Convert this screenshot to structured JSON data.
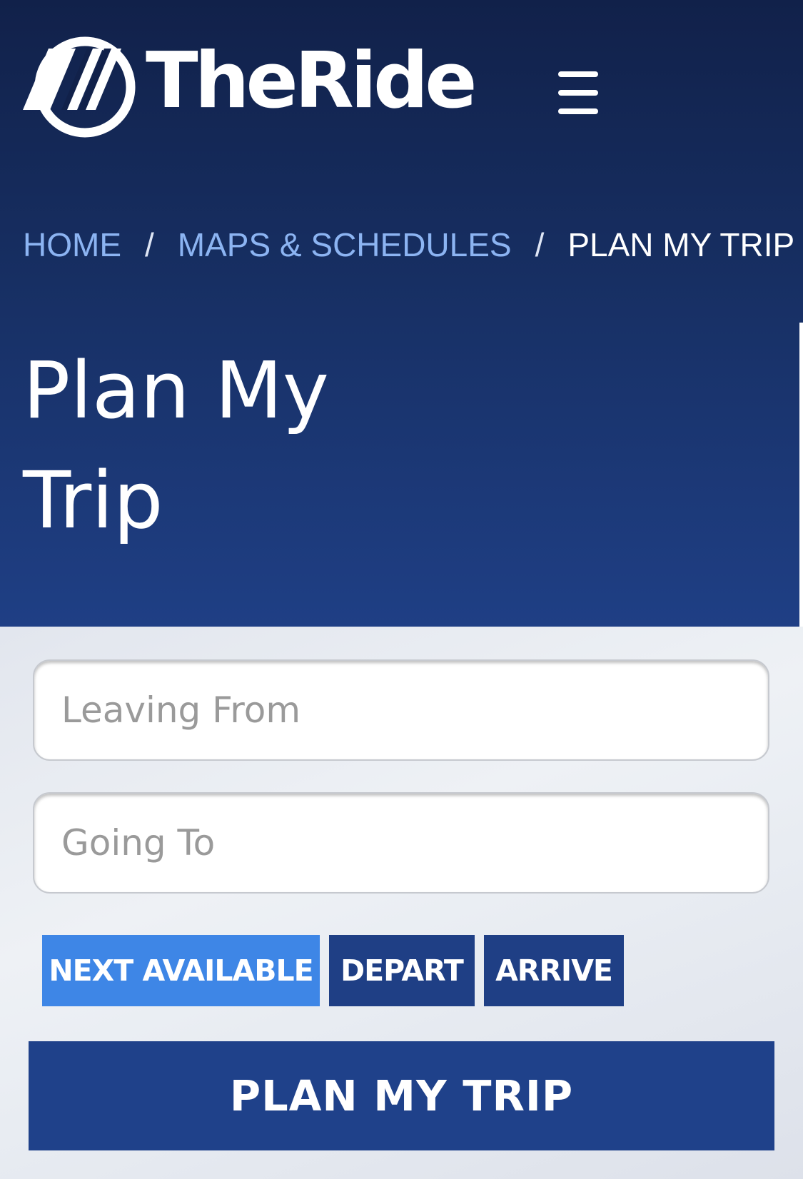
{
  "header": {
    "logo_text": "TheRide",
    "logo_icon": "theride-logo-icon",
    "menu_icon": "hamburger-menu-icon"
  },
  "breadcrumb": {
    "items": [
      {
        "label": "HOME"
      },
      {
        "label": "MAPS & SCHEDULES"
      },
      {
        "label": "PLAN MY TRIP"
      }
    ],
    "separator": "/"
  },
  "page": {
    "title_line1": "Plan My",
    "title_line2": "Trip"
  },
  "form": {
    "leaving_from": {
      "placeholder": "Leaving From",
      "value": ""
    },
    "going_to": {
      "placeholder": "Going To",
      "value": ""
    },
    "modes": [
      {
        "label": "NEXT AVAILABLE",
        "selected": true
      },
      {
        "label": "DEPART",
        "selected": false
      },
      {
        "label": "ARRIVE",
        "selected": false
      }
    ],
    "submit_label": "PLAN MY TRIP"
  },
  "colors": {
    "header_dark": "#11214a",
    "header_bottom": "#1f3f85",
    "link": "#8cb4f2",
    "mode_active": "#3e86e6",
    "mode_inactive": "#1f3f85",
    "submit": "#1f418a"
  }
}
